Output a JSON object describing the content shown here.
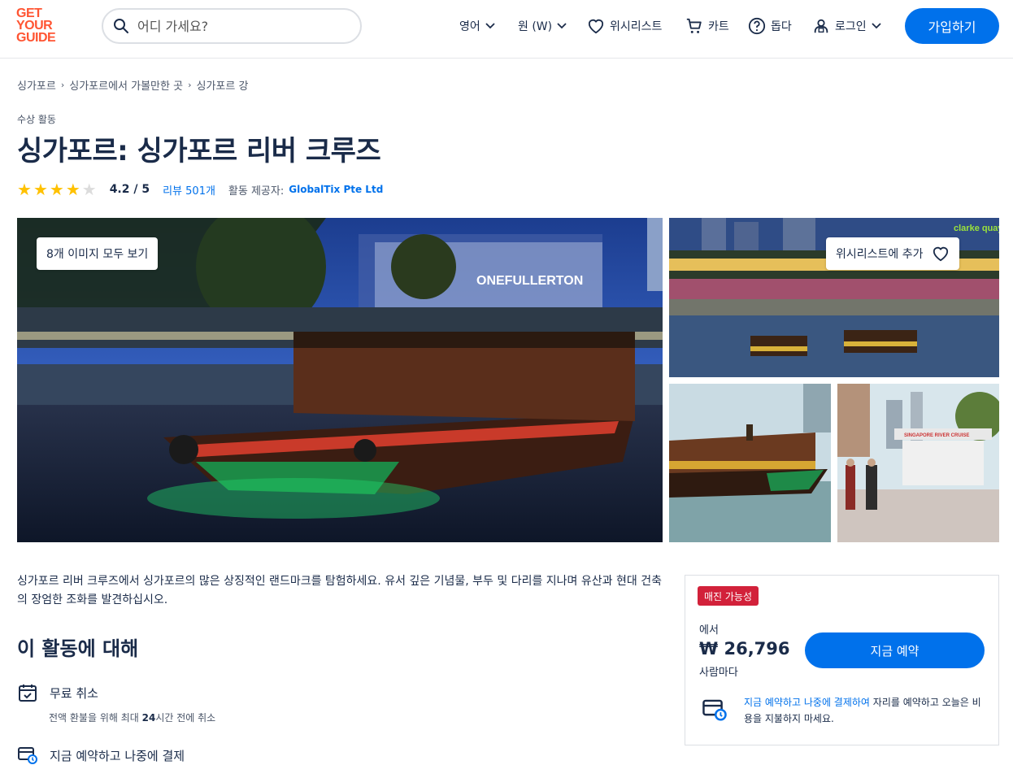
{
  "header": {
    "logo_lines": [
      "GET",
      "YOUR",
      "GUIDE"
    ],
    "search_placeholder": "어디 가세요?",
    "language": "영어",
    "currency": "원 (W)",
    "wishlist": "위시리스트",
    "cart": "카트",
    "help": "돕다",
    "login": "로그인",
    "signup": "가입하기"
  },
  "breadcrumb": [
    "싱가포르",
    "싱가포르에서 가볼만한 곳",
    "싱가포르 강"
  ],
  "category": "수상 활동",
  "title": "싱가포르: 싱가포르 리버 크루즈",
  "rating": {
    "stars": 4,
    "max": 5,
    "score": "4.2 / 5",
    "reviews": "리뷰 501개",
    "provider_label": "활동 제공자:",
    "provider": "GlobalTix Pte Ltd"
  },
  "gallery": {
    "view_all": "8개 이미지 모두 보기",
    "add_wishlist": "위시리스트에 추가",
    "main_sign": "ONEFULLERTON",
    "top_sign": "clarke quay",
    "boat_number": "RC 34",
    "river_sign": "SINGAPORE RIVER CRUISE"
  },
  "description": "싱가포르 리버 크루즈에서 싱가포르의 많은 상징적인 랜드마크를 탐험하세요. 유서 깊은 기념물, 부두 및 다리를 지나며 유산과 현대 건축의 장엄한 조화를 발견하십시오.",
  "about": {
    "heading": "이 활동에 대해",
    "features": [
      {
        "title": "무료 취소",
        "sub_prefix": "전액 환불을 위해 최대 ",
        "sub_bold": "24",
        "sub_suffix": "시간 전에 취소"
      },
      {
        "title": "지금 예약하고 나중에 결제"
      }
    ]
  },
  "booking": {
    "badge": "매진 가능성",
    "from": "에서",
    "price": "₩ 26,796",
    "per": "사람마다",
    "button": "지금 예약",
    "note_link": "지금 예약하고 나중에 결제하여",
    "note_rest": " 자리를 예약하고 오늘은 비용을 지불하지 마세요."
  },
  "colors": {
    "brand": "#ff5533",
    "primary": "#0071eb",
    "badge": "#d2213a",
    "star": "#ffc100"
  }
}
